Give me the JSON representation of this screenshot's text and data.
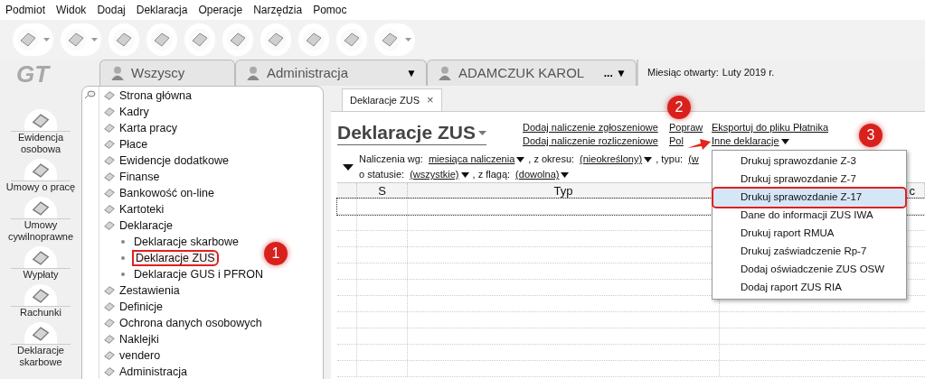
{
  "menu_bar": [
    "Podmiot",
    "Widok",
    "Dodaj",
    "Deklaracja",
    "Operacje",
    "Narzędzia",
    "Pomoc"
  ],
  "toolbar": [
    {
      "kind": "dropdown"
    },
    {
      "kind": "dropdown"
    },
    {
      "kind": "plain"
    },
    {
      "kind": "plain"
    },
    {
      "kind": "plain"
    },
    {
      "kind": "plain"
    },
    {
      "kind": "plain"
    },
    {
      "kind": "plain"
    },
    {
      "kind": "plain"
    },
    {
      "kind": "dropdown"
    }
  ],
  "logo": "GT",
  "context_tabs": [
    {
      "label": "Wszyscy"
    },
    {
      "label": "Administracja",
      "menu": "▼"
    },
    {
      "label": "ADAMCZUK KAROL",
      "menu": "... ▼"
    }
  ],
  "month": {
    "label": "Miesiąc otwarty:",
    "value": "Luty 2019 r."
  },
  "nav": [
    {
      "label": "Ewidencja osobowa"
    },
    {
      "label": "Umowy o pracę"
    },
    {
      "label": "Umowy cywilnoprawne"
    },
    {
      "label": "Wypłaty"
    },
    {
      "label": "Rachunki"
    },
    {
      "label": "Deklaracje skarbowe"
    }
  ],
  "tree": [
    {
      "label": "Strona główna",
      "selected": false
    },
    {
      "label": "Kadry",
      "selected": false
    },
    {
      "label": "Karta pracy",
      "selected": false
    },
    {
      "label": "Płace",
      "selected": false
    },
    {
      "label": "Ewidencje dodatkowe",
      "selected": false
    },
    {
      "label": "Finanse",
      "selected": false
    },
    {
      "label": "Bankowość on-line",
      "selected": false
    },
    {
      "label": "Kartoteki",
      "selected": false
    },
    {
      "label": "Deklaracje",
      "selected": false,
      "children": [
        {
          "label": "Deklaracje skarbowe",
          "selected": false
        },
        {
          "label": "Deklaracje ZUS",
          "selected": true
        },
        {
          "label": "Deklaracje GUS i PFRON",
          "selected": false
        }
      ]
    },
    {
      "label": "Zestawienia",
      "selected": false
    },
    {
      "label": "Definicje",
      "selected": false
    },
    {
      "label": "Ochrona danych osobowych",
      "selected": false
    },
    {
      "label": "Naklejki",
      "selected": false
    },
    {
      "label": "vendero",
      "selected": false
    },
    {
      "label": "Administracja",
      "selected": false
    }
  ],
  "doc_tab": {
    "label": "Deklaracje ZUS",
    "close": "×"
  },
  "header": {
    "title": "Deklaracje ZUS",
    "links_col1": [
      "Dodaj naliczenie zgłoszeniowe",
      "Dodaj naliczenie rozliczeniowe"
    ],
    "links_col2": [
      "Popraw",
      "Pol"
    ],
    "links_col3": [
      "Eksportuj do pliku Płatnika",
      "Inne deklaracje"
    ]
  },
  "filters": [
    [
      {
        "label": "Naliczenia wg:",
        "value": "miesiąca naliczenia"
      },
      {
        "label": ", z okresu:",
        "value": "(nieokreślony)"
      },
      {
        "label": ", typu:",
        "value": "(w"
      }
    ],
    [
      {
        "label": "o statusie:",
        "value": "(wszystkie)"
      },
      {
        "label": ", z flagą:",
        "value": "(dowolna)"
      }
    ]
  ],
  "table": {
    "columns": [
      "S",
      "Typ",
      "c"
    ]
  },
  "dropdown_menu": [
    {
      "label": "Drukuj sprawozdanie Z-3",
      "selected": false
    },
    {
      "label": "Drukuj sprawozdanie Z-7",
      "selected": false
    },
    {
      "label": "Drukuj sprawozdanie Z-17",
      "selected": true
    },
    {
      "label": "Dane do informacji ZUS IWA",
      "selected": false
    },
    {
      "label": "Drukuj raport RMUA",
      "selected": false
    },
    {
      "label": "Drukuj zaświadczenie Rp-7",
      "selected": false
    },
    {
      "label": "Dodaj oświadczenie ZUS OSW",
      "selected": false
    },
    {
      "label": "Dodaj raport ZUS RIA",
      "selected": false
    }
  ],
  "annotations": [
    "1",
    "2",
    "3"
  ]
}
